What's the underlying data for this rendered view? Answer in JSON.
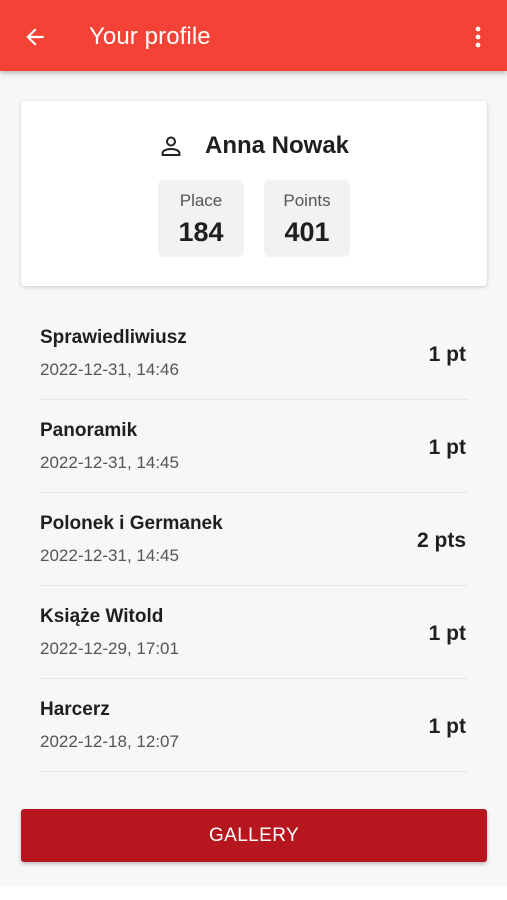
{
  "colors": {
    "app_bar": "#f44336",
    "button": "#b7161f",
    "background": "#f7f7f7"
  },
  "app_bar": {
    "back_icon": "arrow-left-icon",
    "title": "Your profile",
    "menu_icon": "more-vertical-icon"
  },
  "profile": {
    "user_icon": "user-outline-icon",
    "name": "Anna Nowak",
    "stats": [
      {
        "label": "Place",
        "value": "184"
      },
      {
        "label": "Points",
        "value": "401"
      }
    ]
  },
  "activities": [
    {
      "title": "Sprawiedliwiusz",
      "date": "2022-12-31, 14:46",
      "points": "1 pt"
    },
    {
      "title": "Panoramik",
      "date": "2022-12-31, 14:45",
      "points": "1 pt"
    },
    {
      "title": "Polonek i Germanek",
      "date": "2022-12-31, 14:45",
      "points": "2 pts"
    },
    {
      "title": "Książe Witold",
      "date": "2022-12-29, 17:01",
      "points": "1 pt"
    },
    {
      "title": "Harcerz",
      "date": "2022-12-18, 12:07",
      "points": "1 pt"
    }
  ],
  "gallery_button": "GALLERY"
}
